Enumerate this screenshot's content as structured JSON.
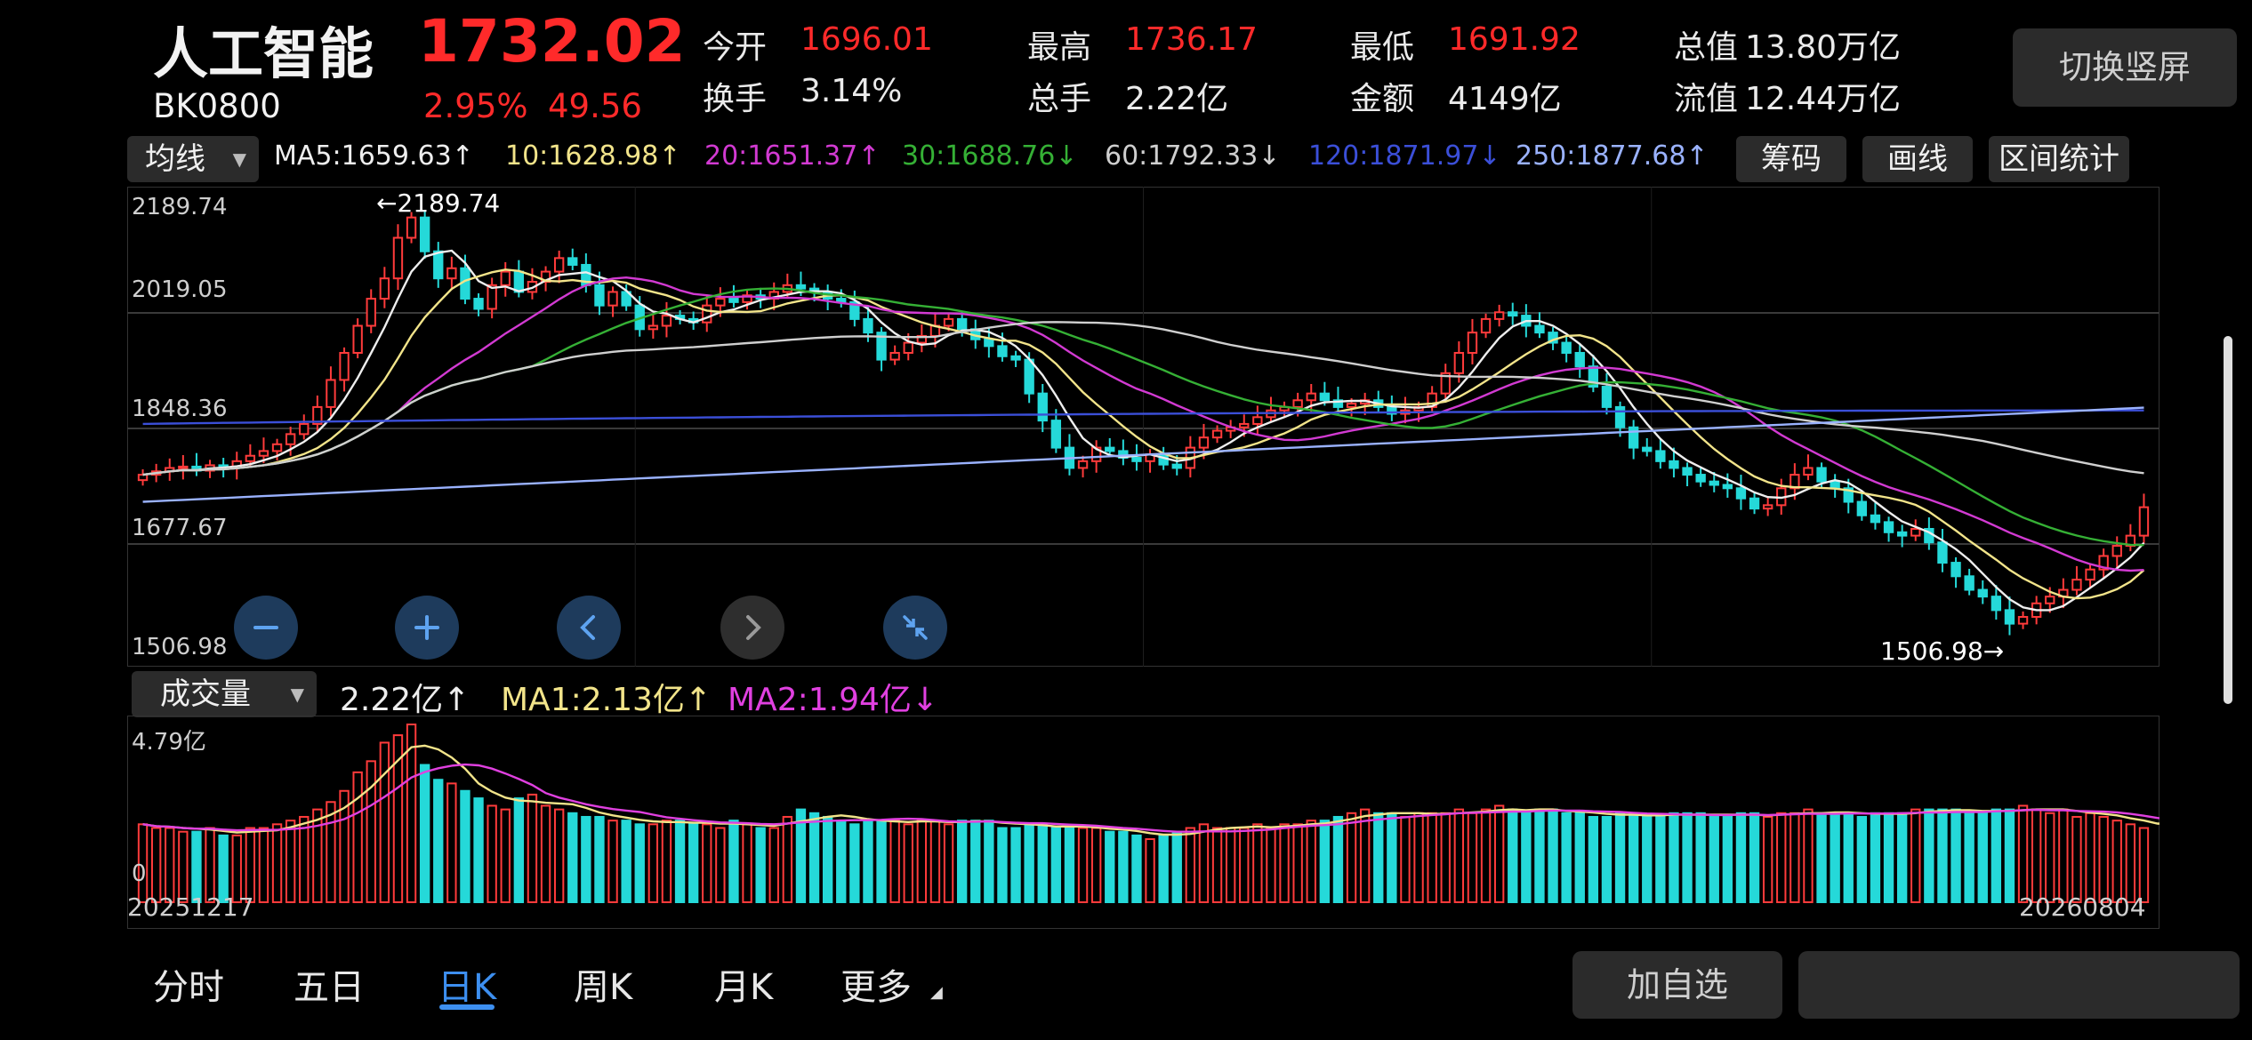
{
  "header": {
    "name": "人工智能",
    "code": "BK0800",
    "price": "1732.02",
    "change_pct": "2.95%",
    "change_abs": "49.56",
    "switch_label": "切换竖屏",
    "stats": [
      {
        "label": "今开",
        "value": "1696.01",
        "color": "#ff2a2a"
      },
      {
        "label": "最高",
        "value": "1736.17",
        "color": "#ff2a2a"
      },
      {
        "label": "最低",
        "value": "1691.92",
        "color": "#ff2a2a"
      },
      {
        "label": "总值",
        "value": "13.80万亿",
        "color": "#eaeaea"
      },
      {
        "label": "换手",
        "value": "3.14%",
        "color": "#eaeaea"
      },
      {
        "label": "总手",
        "value": "2.22亿",
        "color": "#eaeaea"
      },
      {
        "label": "金额",
        "value": "4149亿",
        "color": "#eaeaea"
      },
      {
        "label": "流值",
        "value": "12.44万亿",
        "color": "#eaeaea"
      }
    ]
  },
  "kline_toolbar": {
    "indicator_select": "均线",
    "ma": [
      {
        "text": "MA5:1659.63↑",
        "color": "#eeeeee"
      },
      {
        "text": "10:1628.98↑",
        "color": "#f2e48a"
      },
      {
        "text": "20:1651.37↑",
        "color": "#d23ad2"
      },
      {
        "text": "30:1688.76↓",
        "color": "#35b035"
      },
      {
        "text": "60:1792.33↓",
        "color": "#cfcfcf"
      },
      {
        "text": "120:1871.97↓",
        "color": "#3b4fd8"
      },
      {
        "text": "250:1877.68↑",
        "color": "#9ab2ff"
      }
    ],
    "buttons": [
      "筹码",
      "画线",
      "区间统计"
    ]
  },
  "kline_axis": {
    "ticks": [
      "2189.74",
      "2019.05",
      "1848.36",
      "1677.67",
      "1506.98"
    ],
    "high_marker": "←2189.74",
    "low_marker": "1506.98→"
  },
  "controls": [
    "zoom-out",
    "zoom-in",
    "pan-left",
    "pan-right",
    "collapse"
  ],
  "volume_toolbar": {
    "indicator_select": "成交量",
    "items": [
      {
        "text": "2.22亿↑",
        "color": "#eeeeee"
      },
      {
        "text": "MA1:2.13亿↑",
        "color": "#f2e48a"
      },
      {
        "text": "MA2:1.94亿↓",
        "color": "#e040e0"
      }
    ],
    "axis_top": "4.79亿",
    "axis_zero": "0"
  },
  "dates": {
    "start": "20251217",
    "end": "20260804"
  },
  "tabs": [
    {
      "label": "分时",
      "active": false
    },
    {
      "label": "五日",
      "active": false
    },
    {
      "label": "日K",
      "active": true
    },
    {
      "label": "周K",
      "active": false
    },
    {
      "label": "月K",
      "active": false
    },
    {
      "label": "更多",
      "active": false
    }
  ],
  "add_watch_label": "加自选",
  "chart_data": {
    "type": "candlestick",
    "start_date": "20251217",
    "end_date": "20260804",
    "y_range": [
      1506.98,
      2189.74
    ],
    "y_ticks": [
      2189.74,
      2019.05,
      1848.36,
      1677.67,
      1506.98
    ],
    "volume_max": 4.79,
    "volume_unit": "亿",
    "close": [
      1780,
      1785,
      1790,
      1792,
      1786,
      1794,
      1790,
      1800,
      1808,
      1815,
      1825,
      1840,
      1855,
      1880,
      1920,
      1960,
      2000,
      2040,
      2070,
      2130,
      2160,
      2110,
      2070,
      2085,
      2040,
      2025,
      2060,
      2080,
      2050,
      2065,
      2080,
      2100,
      2090,
      2060,
      2030,
      2050,
      2030,
      1995,
      2000,
      2015,
      2010,
      2005,
      2030,
      2040,
      2035,
      2045,
      2040,
      2050,
      2060,
      2055,
      2050,
      2040,
      2035,
      2010,
      1990,
      1950,
      1960,
      1975,
      1985,
      2000,
      2010,
      1995,
      1980,
      1970,
      1955,
      1950,
      1900,
      1860,
      1820,
      1790,
      1800,
      1820,
      1815,
      1805,
      1800,
      1810,
      1795,
      1790,
      1820,
      1835,
      1845,
      1850,
      1855,
      1865,
      1875,
      1880,
      1890,
      1900,
      1890,
      1880,
      1885,
      1890,
      1880,
      1870,
      1875,
      1880,
      1900,
      1930,
      1960,
      1990,
      2010,
      2020,
      2015,
      2000,
      1990,
      1975,
      1960,
      1940,
      1910,
      1880,
      1850,
      1820,
      1815,
      1800,
      1790,
      1780,
      1770,
      1765,
      1760,
      1745,
      1730,
      1735,
      1760,
      1780,
      1790,
      1770,
      1760,
      1740,
      1720,
      1710,
      1695,
      1690,
      1700,
      1680,
      1650,
      1630,
      1610,
      1600,
      1580,
      1560,
      1570,
      1590,
      1600,
      1610,
      1625,
      1640,
      1660,
      1675,
      1690,
      1732
    ],
    "volume": [
      2.1,
      2.0,
      2.0,
      1.9,
      1.9,
      2.0,
      1.8,
      1.8,
      2.0,
      2.0,
      2.1,
      2.2,
      2.3,
      2.5,
      2.7,
      3.0,
      3.5,
      3.8,
      4.3,
      4.5,
      4.79,
      3.7,
      3.3,
      3.2,
      3.0,
      2.8,
      2.6,
      2.5,
      2.8,
      2.9,
      2.6,
      2.5,
      2.4,
      2.3,
      2.3,
      2.2,
      2.2,
      2.1,
      2.1,
      2.2,
      2.2,
      2.1,
      2.1,
      2.0,
      2.2,
      2.1,
      2.0,
      2.0,
      2.3,
      2.5,
      2.4,
      2.3,
      2.2,
      2.1,
      2.2,
      2.2,
      2.2,
      2.1,
      2.2,
      2.2,
      2.1,
      2.2,
      2.2,
      2.2,
      2.0,
      2.0,
      2.1,
      2.1,
      2.0,
      2.0,
      2.0,
      2.0,
      1.9,
      1.9,
      1.8,
      1.7,
      1.8,
      1.9,
      2.0,
      2.1,
      2.0,
      2.0,
      2.0,
      2.1,
      2.0,
      2.1,
      2.1,
      2.2,
      2.2,
      2.3,
      2.4,
      2.5,
      2.4,
      2.4,
      2.3,
      2.4,
      2.4,
      2.4,
      2.5,
      2.4,
      2.5,
      2.6,
      2.5,
      2.4,
      2.5,
      2.5,
      2.4,
      2.4,
      2.3,
      2.3,
      2.4,
      2.4,
      2.3,
      2.3,
      2.4,
      2.4,
      2.4,
      2.3,
      2.3,
      2.4,
      2.4,
      2.3,
      2.4,
      2.4,
      2.5,
      2.4,
      2.4,
      2.4,
      2.3,
      2.4,
      2.4,
      2.4,
      2.5,
      2.5,
      2.5,
      2.5,
      2.4,
      2.4,
      2.5,
      2.5,
      2.6,
      2.5,
      2.4,
      2.5,
      2.3,
      2.4,
      2.3,
      2.2,
      2.1,
      2.0,
      2.0,
      2.2
    ]
  }
}
